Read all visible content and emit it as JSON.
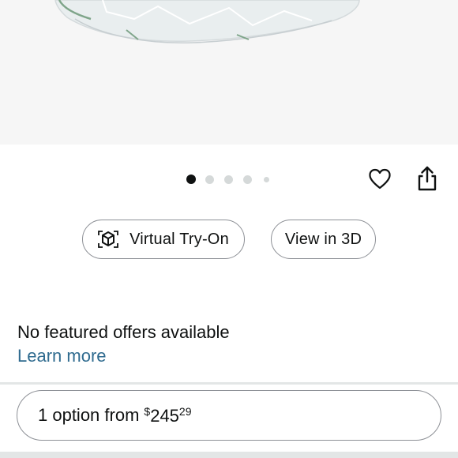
{
  "product_image": {
    "image_index": 1,
    "image_count": 5
  },
  "actions": {
    "wishlist_icon": "heart-icon",
    "share_icon": "share-icon"
  },
  "buttons": {
    "virtual_try_on": "Virtual Try-On",
    "view_in_3d": "View in 3D"
  },
  "offers": {
    "no_offers_text": "No featured offers available",
    "learn_more": "Learn more"
  },
  "options": {
    "prefix": "1 option from",
    "currency_symbol": "$",
    "price_whole": "245",
    "price_fraction": "29"
  },
  "colors": {
    "link": "#2f6b8f",
    "border": "#8d9096",
    "dot_active": "#0f1111",
    "dot_inactive": "#d5d9d9"
  }
}
